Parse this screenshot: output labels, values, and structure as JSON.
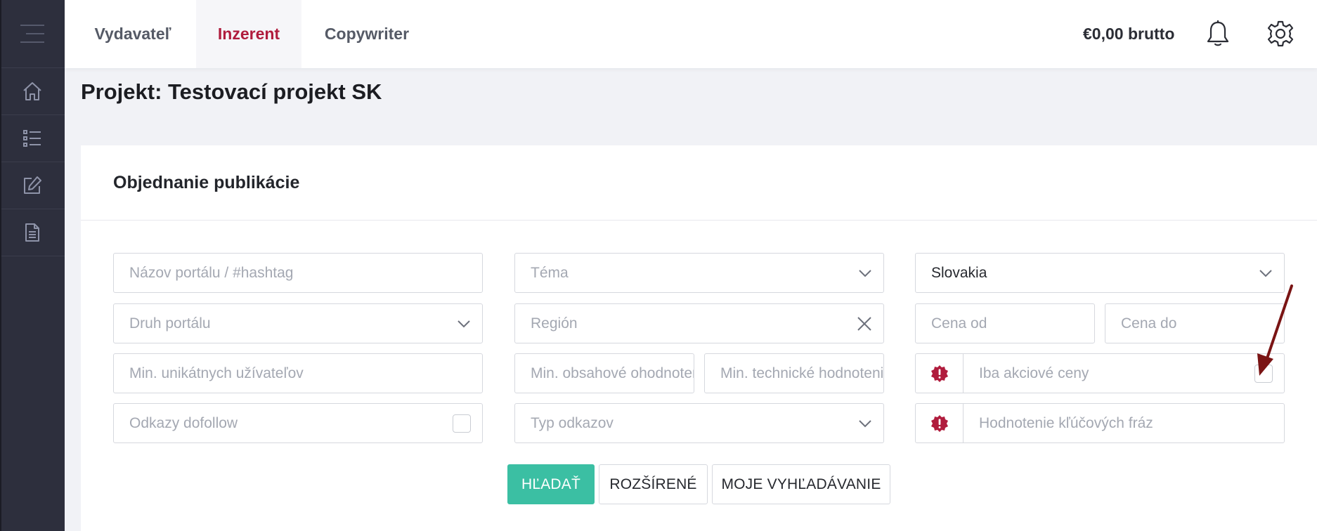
{
  "nav": {
    "tabs": [
      {
        "label": "Vydavateľ"
      },
      {
        "label": "Inzerent"
      },
      {
        "label": "Copywriter"
      }
    ],
    "balance": "€0,00 brutto"
  },
  "page": {
    "title": "Projekt: Testovací projekt SK"
  },
  "card": {
    "title": "Objednanie publikácie"
  },
  "filters": {
    "portal_name": {
      "placeholder": "Názov portálu / #hashtag"
    },
    "theme": {
      "placeholder": "Téma"
    },
    "country": {
      "value": "Slovakia"
    },
    "portal_type": {
      "placeholder": "Druh portálu"
    },
    "region": {
      "placeholder": "Región"
    },
    "price_from": {
      "placeholder": "Cena od"
    },
    "price_to": {
      "placeholder": "Cena do"
    },
    "min_unique_users": {
      "placeholder": "Min. unikátnych užívateľov"
    },
    "min_content_rating": {
      "placeholder": "Min. obsahové ohodnotenie"
    },
    "min_technical_rating": {
      "placeholder": "Min. technické hodnotenie"
    },
    "promo_prices": {
      "label": "Iba akciové ceny"
    },
    "dofollow": {
      "label": "Odkazy dofollow"
    },
    "link_type": {
      "placeholder": "Typ odkazov"
    },
    "keyword_rating": {
      "placeholder": "Hodnotenie kľúčových fráz"
    }
  },
  "buttons": {
    "search": "HĽADAŤ",
    "advanced": "ROZŠÍRENÉ",
    "my_searches": "MOJE VYHĽADÁVANIE"
  },
  "colors": {
    "sidebar": "#2d2f3d",
    "active_tab": "#b01c3d",
    "primary_button": "#3bbfa3",
    "alert_icon": "#b01c3d",
    "arrow": "#7a1414"
  }
}
